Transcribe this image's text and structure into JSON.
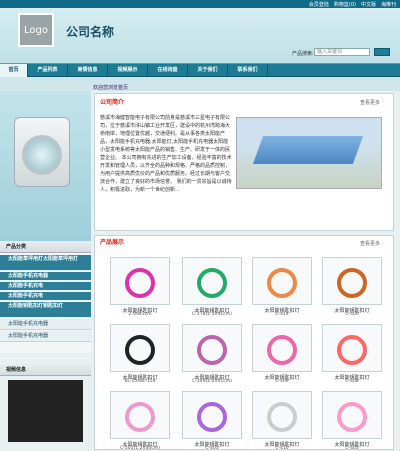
{
  "top_links": [
    "会员登陆",
    "购物篮(0)",
    "中文版",
    "海推刊"
  ],
  "header": {
    "logo": "Logo",
    "company": "公司名称",
    "search_label": "产品搜索:",
    "search_placeholder": "输入关键词"
  },
  "nav": [
    "首页",
    "产品列表",
    "商情信息",
    "视频展示",
    "在线询盘",
    "关于我们",
    "联系我们"
  ],
  "breadcrumb": "欢迎您浏览首页",
  "sidebar": {
    "category_title": "产品分类",
    "categories": [
      {
        "label": "太阳能草坪用灯太阳能草坪用灯",
        "type": "cat"
      },
      {
        "label": "太阳能手机充电器",
        "type": "cat"
      },
      {
        "label": "太阳能手机充电",
        "type": "cat"
      },
      {
        "label": "太阳能手机充电",
        "type": "cat"
      },
      {
        "label": "太阳能钥匙扣灯钥匙扣灯",
        "type": "cat"
      },
      {
        "label": "太阳能手机充电器",
        "type": "sub"
      },
      {
        "label": "太阳能手机充电器",
        "type": "sub"
      }
    ],
    "video_title": "视频信息"
  },
  "about": {
    "title": "公司简介",
    "more": "查看更多",
    "text": "慈溪市海健智能电子有限公司前身是慈溪市三星电子有限公司，位于慈溪市浒山镇工业开发区，建设中的杭州湾跨海大桥南岸，地理位置优越，交通便利。是从事各类太阳能产品，太阳能手机充电器,太阳能灯,太阳能手机充电器太阳能小型发电系统等太阳能产品的销售、生产、研发于一体的民营企业。 本公司拥有先进的生产加工设备，经验丰富的技术开发和管理人员，以齐全的品种和规格、严格的品质控制，为用户提供高质优价的产品和优质服务。经过长期与客户交流合作，建立了良好的市场信誉。 我们的一贯宗旨是以诚待人，积极进取，为新一个世纪创新..."
  },
  "products": {
    "title": "产品展示",
    "more": "查看更多",
    "items": [
      {
        "name": "太阳能钥匙扣灯",
        "code": "Z-0943cm",
        "color": "#d3a"
      },
      {
        "name": "太阳能钥匙扣灯",
        "code": "C-178(2.5X41cm)",
        "color": "#2a6"
      },
      {
        "name": "太阳能钥匙扣灯",
        "code": "C-414",
        "color": "#e84"
      },
      {
        "name": "太阳能钥匙扣灯",
        "code": "C-400",
        "color": "#c62"
      },
      {
        "name": "太阳能钥匙扣灯",
        "code": "KL-1548L-154",
        "color": "#222"
      },
      {
        "name": "太阳能钥匙扣灯",
        "code": "C-149(2.0X41cm)",
        "color": "#b6a"
      },
      {
        "name": "太阳能钥匙扣灯",
        "code": "C-409",
        "color": "#e6a"
      },
      {
        "name": "太阳能钥匙扣灯",
        "code": "C-408",
        "color": "#f66"
      },
      {
        "name": "太阳能钥匙扣灯",
        "code": "C-505(1.2X30cm)",
        "color": "#e9c"
      },
      {
        "name": "太阳能钥匙扣灯",
        "code": "C-403",
        "color": "#a6d"
      },
      {
        "name": "太阳能钥匙扣灯",
        "code": "C-410",
        "color": "#ccc"
      },
      {
        "name": "太阳能钥匙扣灯",
        "code": "C-405",
        "color": "#f9c"
      }
    ]
  }
}
